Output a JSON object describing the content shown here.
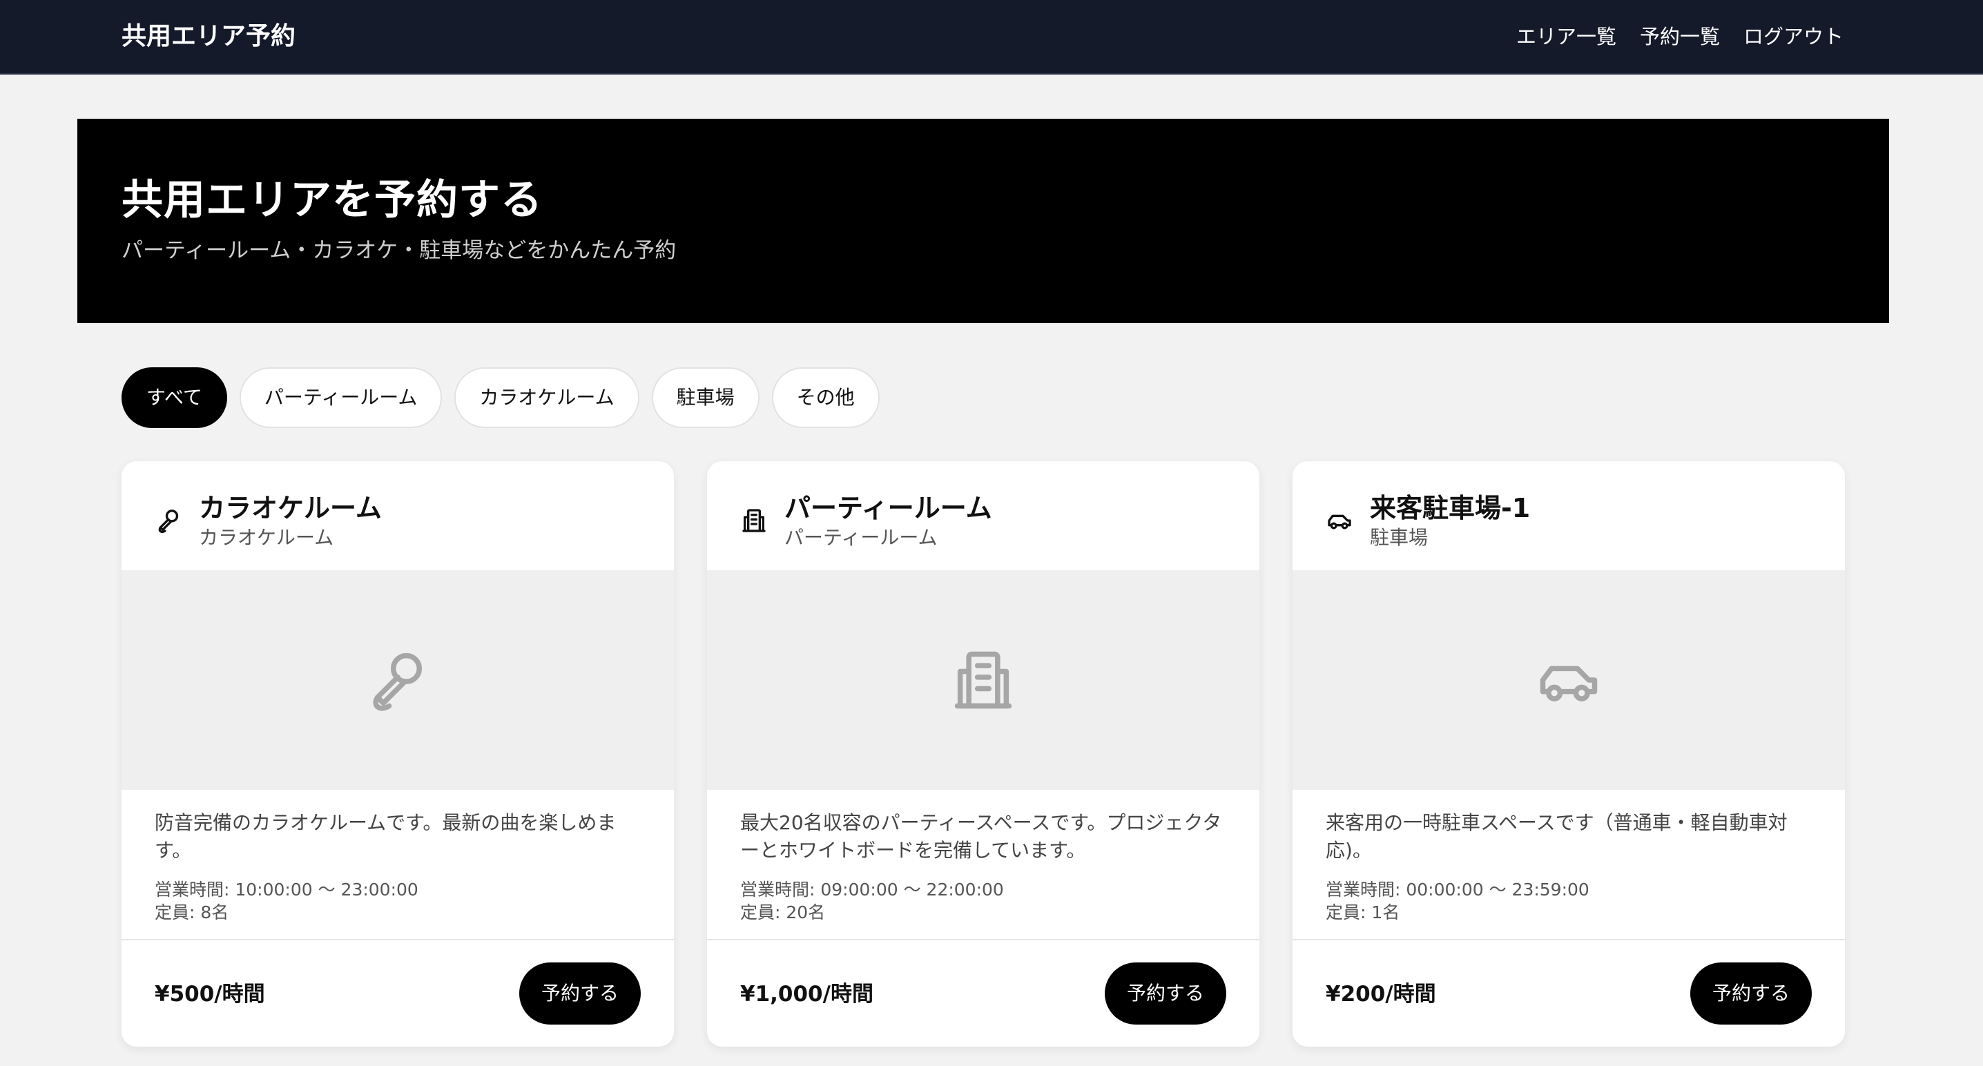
{
  "nav": {
    "brand": "共用エリア予約",
    "links": [
      "エリア一覧",
      "予約一覧",
      "ログアウト"
    ]
  },
  "hero": {
    "title": "共用エリアを予約する",
    "subtitle": "パーティールーム・カラオケ・駐車場などをかんたん予約"
  },
  "filters": {
    "chips": [
      "すべて",
      "パーティールーム",
      "カラオケルーム",
      "駐車場",
      "その他"
    ],
    "selected": "すべて"
  },
  "cards": [
    {
      "icon": "microphone-icon",
      "title": "カラオケルーム",
      "type": "カラオケルーム",
      "description": "防音完備のカラオケルームです。最新の曲を楽しめます。",
      "hours": "営業時間: 10:00:00 〜 23:00:00",
      "capacity": "定員: 8名",
      "price": "¥500/時間",
      "button": "予約する"
    },
    {
      "icon": "building-icon",
      "title": "パーティールーム",
      "type": "パーティールーム",
      "description": "最大20名収容のパーティースペースです。プロジェクターとホワイトボードを完備しています。",
      "hours": "営業時間: 09:00:00 〜 22:00:00",
      "capacity": "定員: 20名",
      "price": "¥1,000/時間",
      "button": "予約する"
    },
    {
      "icon": "car-icon",
      "title": "来客駐車場-1",
      "type": "駐車場",
      "description": "来客用の一時駐車スペースです（普通車・軽自動車対応)。",
      "hours": "営業時間: 00:00:00 〜 23:59:00",
      "capacity": "定員: 1名",
      "price": "¥200/時間",
      "button": "予約する"
    }
  ],
  "colors": {
    "navbar": "#141a2a",
    "hero": "#000000",
    "page_background": "#f2f2f2",
    "accent": "#000000",
    "placeholder_background": "#efefef",
    "placeholder_icon": "#a6a6a6"
  }
}
